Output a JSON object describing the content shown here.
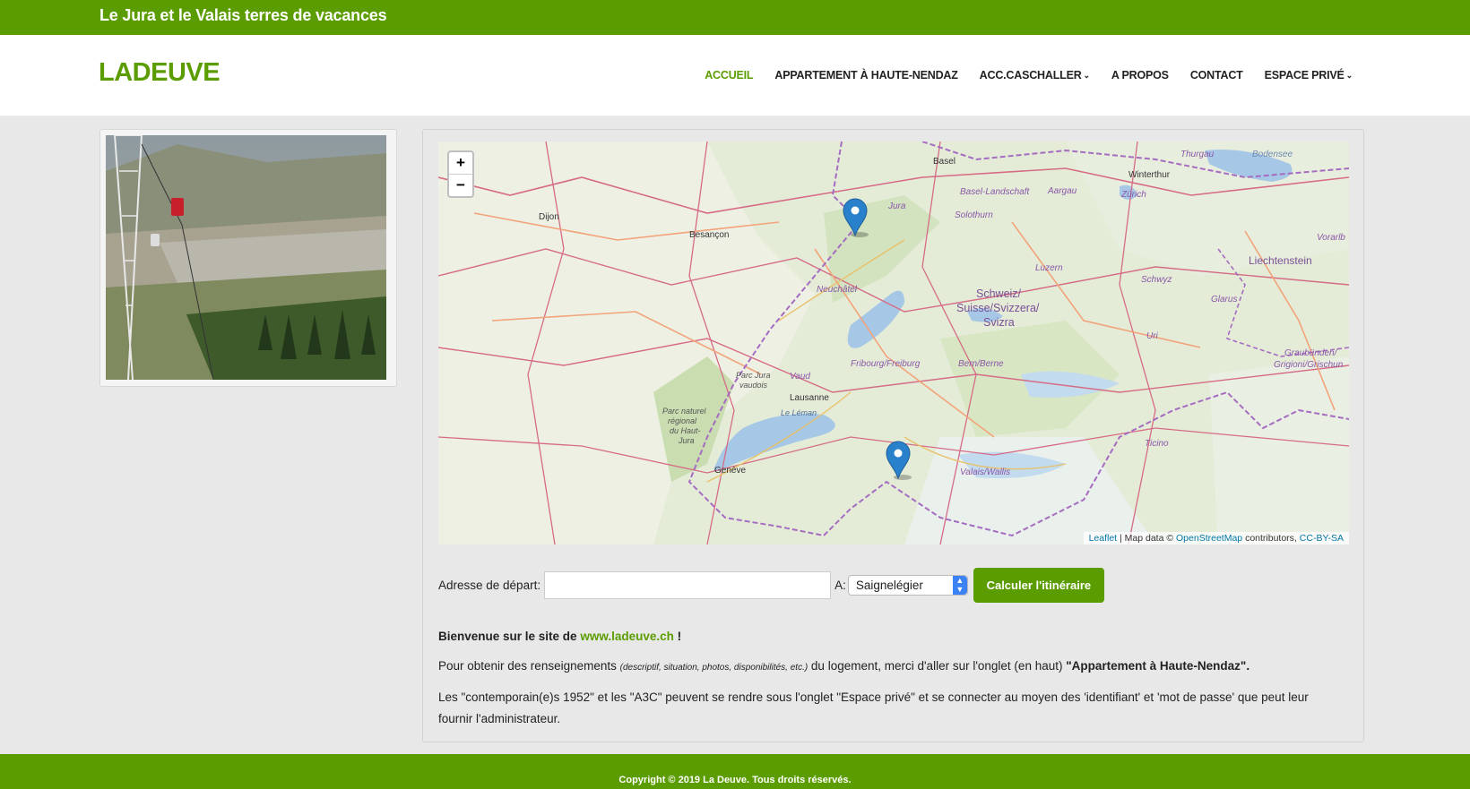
{
  "topbar": {
    "tagline": "Le Jura et le Valais terres de vacances"
  },
  "header": {
    "logo": "LADEUVE",
    "nav": [
      {
        "label": "ACCUEIL",
        "active": true
      },
      {
        "label": "APPARTEMENT À HAUTE-NENDAZ"
      },
      {
        "label": "ACC.CASCHALLER",
        "dropdown": true
      },
      {
        "label": "A PROPOS"
      },
      {
        "label": "CONTACT"
      },
      {
        "label": "ESPACE PRIVÉ",
        "dropdown": true
      }
    ]
  },
  "map": {
    "zoom_in": "+",
    "zoom_out": "−",
    "labels": {
      "basel": "Basel",
      "thurgau": "Thurgau",
      "bodensee": "Bodensee",
      "winterthur": "Winterthur",
      "zurich": "Zürich",
      "basel_landschaft": "Basel-Landschaft",
      "aargau": "Aargau",
      "jura": "Jura",
      "solothurn": "Solothurn",
      "dijon": "Dijon",
      "besancon": "Besançon",
      "vorarlb": "Vorarlb",
      "liechtenstein": "Liechtenstein",
      "luzern": "Luzern",
      "schwyz": "Schwyz",
      "neuchatel": "Neuchâtel",
      "schweiz1": "Schweiz/",
      "schweiz2": "Suisse/Svizzera/",
      "schweiz3": "Svizra",
      "glarus": "Glarus",
      "uri": "Uri",
      "parc_jura_vaudois1": "Parc Jura",
      "parc_jura_vaudois2": "vaudois",
      "vaud": "Vaud",
      "fribourg": "Fribourg/Freiburg",
      "bern": "Bern/Berne",
      "graubunden1": "Graubünden/",
      "graubunden2": "Grigioni/Grischun",
      "lausanne": "Lausanne",
      "leman": "Le Léman",
      "parc_haut_jura1": "Parc naturel",
      "parc_haut_jura2": "régional",
      "parc_haut_jura3": "du Haut-",
      "parc_haut_jura4": "Jura",
      "ticino": "Ticino",
      "geneve": "Genève",
      "valais": "Valais/Wallis"
    },
    "attribution": {
      "leaflet": "Leaflet",
      "sep1": " | Map data © ",
      "osm": "OpenStreetMap",
      "sep2": " contributors, ",
      "license": "CC-BY-SA"
    }
  },
  "route": {
    "from_label": "Adresse de départ:",
    "from_value": "",
    "to_label": "A:",
    "to_value": "Saignelégier",
    "button": "Calculer l'itinéraire"
  },
  "content": {
    "welcome_prefix": "Bienvenue sur le site de ",
    "welcome_link": "www.ladeuve.ch",
    "welcome_suffix": " !",
    "p1_a": "Pour obtenir des renseignements ",
    "p1_small": "(descriptif, situation, photos, disponibilités, etc.)",
    "p1_b": " du logement, merci d'aller sur l'onglet (en haut) ",
    "p1_bold": "\"Appartement à Haute-Nendaz\".",
    "p2": "Les \"contemporain(e)s 1952\" et les \"A3C\" peuvent se rendre sous l'onglet \"Espace privé\" et se connecter au moyen des 'identifiant' et 'mot de passe' que peut leur fournir l'administrateur."
  },
  "footer": {
    "copyright": "Copyright © 2019 La Deuve. Tous droits réservés."
  },
  "colors": {
    "brand": "#5b9d00",
    "link": "#0078a8",
    "marker": "#2a81cb"
  }
}
